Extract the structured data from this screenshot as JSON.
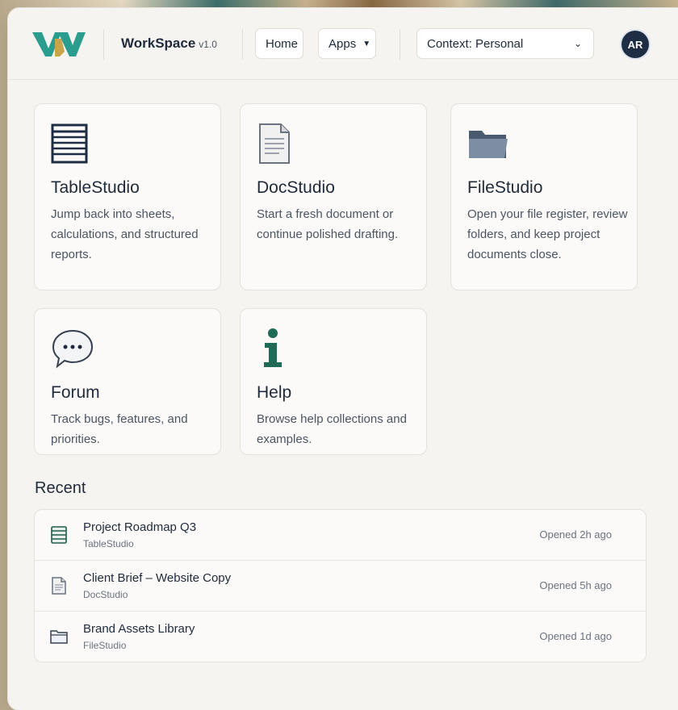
{
  "header": {
    "brand": "WorkSpace",
    "version": "v1.0",
    "nav": {
      "home": "Home",
      "apps": "Apps"
    },
    "context_select": "Context: Personal",
    "avatar_initials": "AR",
    "colors": {
      "logo_teal": "#2a9d8f",
      "logo_gold": "#c9a44a",
      "avatar_bg": "#1f2d44"
    }
  },
  "apps": [
    {
      "title": "TableStudio",
      "description": "Jump back into sheets, calculations, and structured reports.",
      "icon": "table-icon"
    },
    {
      "title": "DocStudio",
      "description": "Start a fresh document or continue polished drafting.",
      "icon": "document-icon"
    },
    {
      "title": "FileStudio",
      "description": "Open your file register, review folders, and keep project documents close.",
      "icon": "folder-icon"
    },
    {
      "title": "Forum",
      "description": "Track bugs, features, and priorities.",
      "icon": "speech-bubble-icon"
    },
    {
      "title": "Help",
      "description": "Browse help collections and examples.",
      "icon": "info-icon"
    }
  ],
  "recent": {
    "title": "Recent",
    "items": [
      {
        "name": "Project Roadmap Q3",
        "app": "TableStudio",
        "opened": "Opened 2h ago",
        "icon": "table-icon"
      },
      {
        "name": "Client Brief – Website Copy",
        "app": "DocStudio",
        "opened": "Opened 5h ago",
        "icon": "document-icon"
      },
      {
        "name": "Brand Assets Library",
        "app": "FileStudio",
        "opened": "Opened 1d ago",
        "icon": "folder-icon"
      }
    ]
  }
}
